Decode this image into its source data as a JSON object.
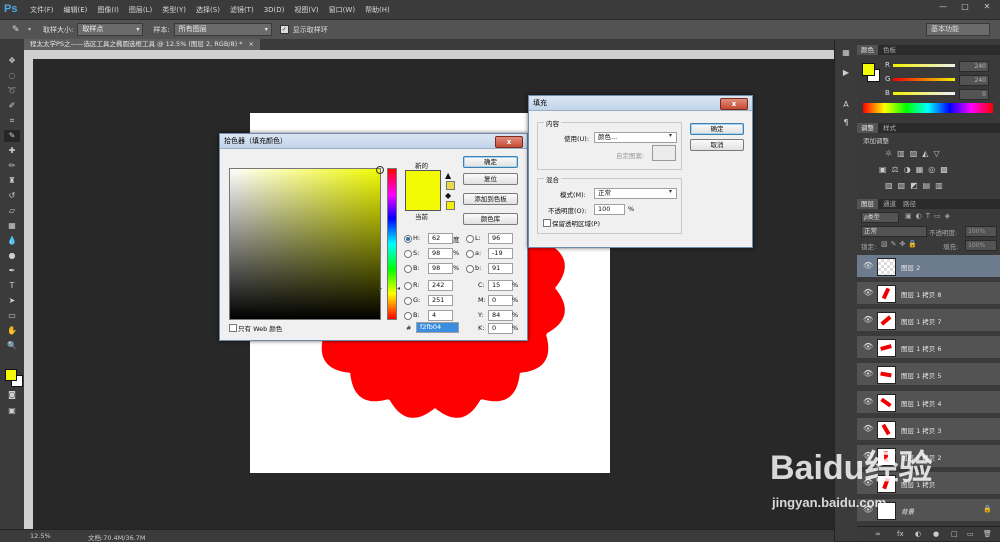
{
  "menu": {
    "logo": "Ps",
    "items": [
      "文件(F)",
      "编辑(E)",
      "图像(I)",
      "图层(L)",
      "类型(Y)",
      "选择(S)",
      "滤镜(T)",
      "3D(D)",
      "视图(V)",
      "窗口(W)",
      "帮助(H)"
    ],
    "win_min": "—",
    "win_max": "□",
    "win_close": "✕"
  },
  "options": {
    "sample_size_label": "取样大小:",
    "sample_size_value": "取样点",
    "sample_label": "样本:",
    "sample_value": "所有图层",
    "show_ring_label": "显示取样环",
    "workspace": "基本功能"
  },
  "document": {
    "tab_title": "程太太学PS之——选区工具之椭圆选框工具 @ 12.5% (图层 2, RGB/8) *",
    "tab_close": "×",
    "zoom": "12.5%",
    "doc_size": "文档:70.4M/36.7M"
  },
  "colors": {
    "foreground": "#f2fb04",
    "background": "#ffffff",
    "shape_fill": "#ff0000",
    "selected_layer": "#6d7b8e"
  },
  "panels": {
    "color_tabs": [
      "颜色",
      "色板"
    ],
    "sliders": [
      {
        "label": "R",
        "value": "240"
      },
      {
        "label": "G",
        "value": "240"
      },
      {
        "label": "B",
        "value": "0"
      }
    ],
    "adjust_tabs": [
      "调整",
      "样式"
    ],
    "adjust_title": "添加调整",
    "layer_tabs": [
      "图层",
      "通道",
      "路径"
    ],
    "layer_kind": "ρ类型",
    "blend_mode": "正常",
    "opacity_label": "不透明度:",
    "opacity_value": "100%",
    "lock_label": "锁定:",
    "fill_label": "填充:",
    "fill_value": "100%",
    "layers": [
      {
        "name": "图层 2"
      },
      {
        "name": "图层 1 拷贝 8"
      },
      {
        "name": "图层 1 拷贝 7"
      },
      {
        "name": "图层 1 拷贝 6"
      },
      {
        "name": "图层 1 拷贝 5"
      },
      {
        "name": "图层 1 拷贝 4"
      },
      {
        "name": "图层 1 拷贝 3"
      },
      {
        "name": "图层 1 拷贝 2"
      },
      {
        "name": "图层 1 拷贝"
      },
      {
        "name": "背景"
      }
    ],
    "footer_icons": [
      "∞",
      "fx",
      "◐",
      "●",
      "□",
      "▭",
      "🗑"
    ]
  },
  "picker": {
    "title": "拾色器（填充颜色）",
    "ok": "确定",
    "reset": "复位",
    "add_swatch": "添加到色板",
    "libraries": "颜色库",
    "new_label": "新的",
    "current_label": "当前",
    "web_only": "只有 Web 颜色",
    "H": "62",
    "S": "98",
    "B": "98",
    "R": "242",
    "G": "251",
    "Bv": "4",
    "L": "96",
    "a": "-19",
    "b": "91",
    "C": "15",
    "M": "0",
    "Y": "84",
    "K": "0",
    "hex": "f2fb04",
    "deg": "度",
    "pct": "%",
    "hash": "#"
  },
  "fill": {
    "title": "填充",
    "content_group": "内容",
    "use_label": "使用(U):",
    "use_value": "颜色...",
    "custom_pattern": "自定图案:",
    "blend_group": "混合",
    "mode_label": "模式(M):",
    "mode_value": "正常",
    "opacity_label": "不透明度(O):",
    "opacity_value": "100",
    "opacity_unit": "%",
    "preserve": "保留透明区域(P)",
    "ok": "确定",
    "cancel": "取消"
  },
  "watermark": {
    "brand": "Baidu经验",
    "url": "jingyan.baidu.com"
  }
}
